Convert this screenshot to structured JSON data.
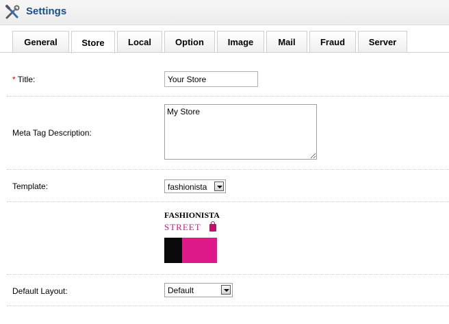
{
  "header": {
    "title": "Settings",
    "icon": "tools-icon"
  },
  "tabs": [
    {
      "label": "General",
      "active": false
    },
    {
      "label": "Store",
      "active": true
    },
    {
      "label": "Local",
      "active": false
    },
    {
      "label": "Option",
      "active": false
    },
    {
      "label": "Image",
      "active": false
    },
    {
      "label": "Mail",
      "active": false
    },
    {
      "label": "Fraud",
      "active": false
    },
    {
      "label": "Server",
      "active": false
    }
  ],
  "form": {
    "title": {
      "required_mark": "*",
      "label": "Title:",
      "value": "Your Store"
    },
    "meta_description": {
      "label": "Meta Tag Description:",
      "value": "My Store"
    },
    "template": {
      "label": "Template:",
      "value": "fashionista"
    },
    "template_preview": {
      "line1": "FASHIONISTA",
      "line2": "STREET"
    },
    "default_layout": {
      "label": "Default Layout:",
      "value": "Default"
    }
  },
  "colors": {
    "accent": "#1b4f87",
    "required": "#cc0000",
    "preview_pink": "#e0198a"
  }
}
